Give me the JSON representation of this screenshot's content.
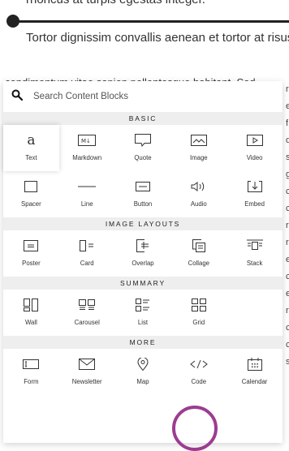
{
  "background": {
    "line1": "rhoncus at turpis egestas integer.",
    "line2": "Tortor dignissim convallis aenean et tortor at risus",
    "line3": "condimentum vitae sapien pellentesque habitant. Sed",
    "right_edge_chars": [
      "r",
      "e",
      "f",
      "d",
      "s",
      "g",
      "c",
      "c",
      "r",
      "r",
      "e",
      "c",
      "e",
      "r",
      "c",
      "c",
      "s"
    ]
  },
  "search": {
    "placeholder": "Search Content Blocks",
    "icon": "search-icon"
  },
  "sections": {
    "basic": {
      "header": "BASIC",
      "items": [
        {
          "label": "Text",
          "icon": "text-a-icon"
        },
        {
          "label": "Markdown",
          "icon": "markdown-icon"
        },
        {
          "label": "Quote",
          "icon": "quote-icon"
        },
        {
          "label": "Image",
          "icon": "image-icon"
        },
        {
          "label": "Video",
          "icon": "video-icon"
        },
        {
          "label": "Spacer",
          "icon": "spacer-icon"
        },
        {
          "label": "Line",
          "icon": "line-icon"
        },
        {
          "label": "Button",
          "icon": "button-icon"
        },
        {
          "label": "Audio",
          "icon": "audio-icon"
        },
        {
          "label": "Embed",
          "icon": "embed-icon"
        }
      ]
    },
    "image_layouts": {
      "header": "IMAGE LAYOUTS",
      "items": [
        {
          "label": "Poster",
          "icon": "poster-icon"
        },
        {
          "label": "Card",
          "icon": "card-icon"
        },
        {
          "label": "Overlap",
          "icon": "overlap-icon"
        },
        {
          "label": "Collage",
          "icon": "collage-icon"
        },
        {
          "label": "Stack",
          "icon": "stack-icon"
        }
      ]
    },
    "summary": {
      "header": "SUMMARY",
      "items": [
        {
          "label": "Wall",
          "icon": "wall-icon"
        },
        {
          "label": "Carousel",
          "icon": "carousel-icon"
        },
        {
          "label": "List",
          "icon": "list-icon"
        },
        {
          "label": "Grid",
          "icon": "grid-icon"
        }
      ]
    },
    "more": {
      "header": "MORE",
      "items": [
        {
          "label": "Form",
          "icon": "form-icon"
        },
        {
          "label": "Newsletter",
          "icon": "newsletter-icon"
        },
        {
          "label": "Map",
          "icon": "map-pin-icon"
        },
        {
          "label": "Code",
          "icon": "code-icon"
        },
        {
          "label": "Calendar",
          "icon": "calendar-icon"
        }
      ]
    }
  },
  "highlight_color": "#9c3c91",
  "selected_item": "Text"
}
